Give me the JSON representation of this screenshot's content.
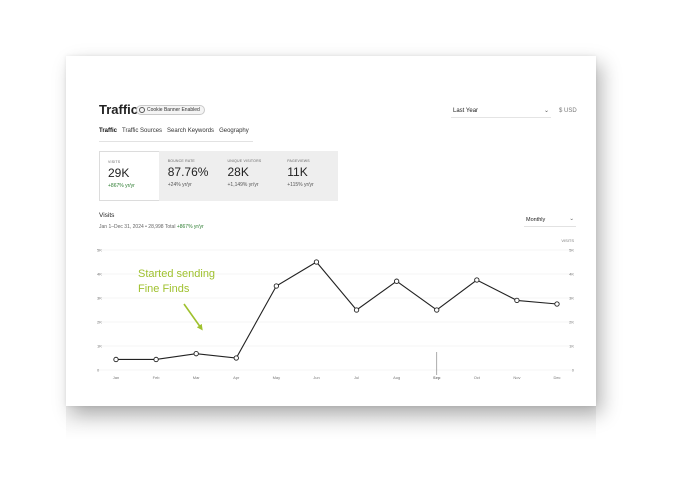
{
  "header": {
    "title": "Traffic",
    "badge": "Cookie Banner Enabled",
    "range_value": "Last Year",
    "currency": "$ USD"
  },
  "tabs": [
    {
      "label": "Traffic",
      "active": true
    },
    {
      "label": "Traffic Sources",
      "active": false
    },
    {
      "label": "Search Keywords",
      "active": false
    },
    {
      "label": "Geography",
      "active": false
    }
  ],
  "metrics": [
    {
      "label": "Visits",
      "value": "29K",
      "change": "+867% yr/yr",
      "active": true
    },
    {
      "label": "Bounce Rate",
      "value": "87.76%",
      "change": "+24% yr/yr",
      "active": false
    },
    {
      "label": "Unique Visitors",
      "value": "28K",
      "change": "+1,149% yr/yr",
      "active": false
    },
    {
      "label": "Pageviews",
      "value": "11K",
      "change": "+115% yr/yr",
      "active": false
    }
  ],
  "visits": {
    "title": "Visits",
    "subtitle_prefix": "Jan 1–Dec 31, 2024 • 28,998 Total ",
    "subtitle_change": "+867% yr/yr",
    "interval": "Monthly"
  },
  "annotation": {
    "line1": "Started sending",
    "line2": "Fine Finds"
  },
  "colors": {
    "accent_green": "#9fc12e",
    "positive": "#2e7d32",
    "line": "#222222"
  },
  "chart_data": {
    "type": "line",
    "categories": [
      "Jan",
      "Feb",
      "Mar",
      "Apr",
      "May",
      "Jun",
      "Jul",
      "Aug",
      "Sep",
      "Oct",
      "Nov",
      "Dec"
    ],
    "series": [
      {
        "values": [
          440,
          440,
          680,
          500,
          3500,
          4500,
          2500,
          3700,
          2500,
          3750,
          2900,
          2750
        ]
      }
    ],
    "y_ticks": [
      "0",
      "1K",
      "2K",
      "3K",
      "4K",
      "5K"
    ],
    "right_axis_label": "VISITS",
    "ylim": [
      0,
      5000
    ],
    "grid": true,
    "highlight_category": "Sep"
  }
}
